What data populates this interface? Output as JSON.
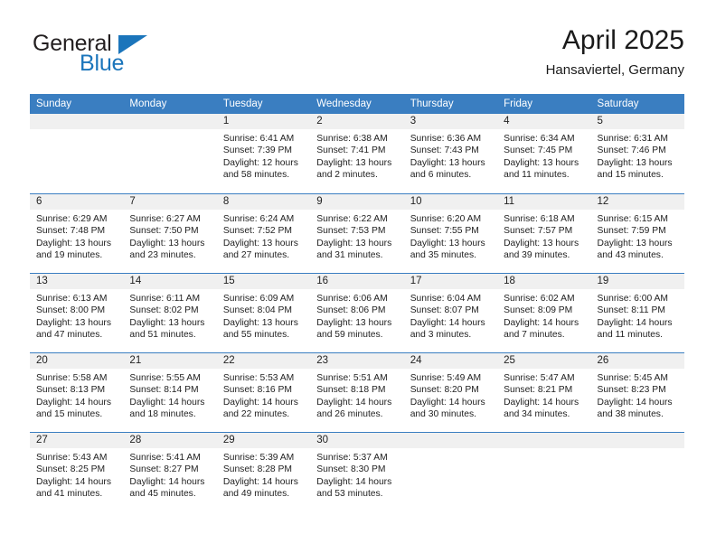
{
  "brand": {
    "name_part1": "General",
    "name_part2": "Blue",
    "triangle_color": "#1b75bb"
  },
  "header": {
    "title": "April 2025",
    "subtitle": "Hansaviertel, Germany"
  },
  "theme": {
    "header_blue": "#3a7ec1",
    "date_band": "#f0f0f0",
    "text": "#222222"
  },
  "weekdays": [
    "Sunday",
    "Monday",
    "Tuesday",
    "Wednesday",
    "Thursday",
    "Friday",
    "Saturday"
  ],
  "weeks": [
    [
      {
        "date": "",
        "lines": []
      },
      {
        "date": "",
        "lines": []
      },
      {
        "date": "1",
        "lines": [
          "Sunrise: 6:41 AM",
          "Sunset: 7:39 PM",
          "Daylight: 12 hours",
          "and 58 minutes."
        ]
      },
      {
        "date": "2",
        "lines": [
          "Sunrise: 6:38 AM",
          "Sunset: 7:41 PM",
          "Daylight: 13 hours",
          "and 2 minutes."
        ]
      },
      {
        "date": "3",
        "lines": [
          "Sunrise: 6:36 AM",
          "Sunset: 7:43 PM",
          "Daylight: 13 hours",
          "and 6 minutes."
        ]
      },
      {
        "date": "4",
        "lines": [
          "Sunrise: 6:34 AM",
          "Sunset: 7:45 PM",
          "Daylight: 13 hours",
          "and 11 minutes."
        ]
      },
      {
        "date": "5",
        "lines": [
          "Sunrise: 6:31 AM",
          "Sunset: 7:46 PM",
          "Daylight: 13 hours",
          "and 15 minutes."
        ]
      }
    ],
    [
      {
        "date": "6",
        "lines": [
          "Sunrise: 6:29 AM",
          "Sunset: 7:48 PM",
          "Daylight: 13 hours",
          "and 19 minutes."
        ]
      },
      {
        "date": "7",
        "lines": [
          "Sunrise: 6:27 AM",
          "Sunset: 7:50 PM",
          "Daylight: 13 hours",
          "and 23 minutes."
        ]
      },
      {
        "date": "8",
        "lines": [
          "Sunrise: 6:24 AM",
          "Sunset: 7:52 PM",
          "Daylight: 13 hours",
          "and 27 minutes."
        ]
      },
      {
        "date": "9",
        "lines": [
          "Sunrise: 6:22 AM",
          "Sunset: 7:53 PM",
          "Daylight: 13 hours",
          "and 31 minutes."
        ]
      },
      {
        "date": "10",
        "lines": [
          "Sunrise: 6:20 AM",
          "Sunset: 7:55 PM",
          "Daylight: 13 hours",
          "and 35 minutes."
        ]
      },
      {
        "date": "11",
        "lines": [
          "Sunrise: 6:18 AM",
          "Sunset: 7:57 PM",
          "Daylight: 13 hours",
          "and 39 minutes."
        ]
      },
      {
        "date": "12",
        "lines": [
          "Sunrise: 6:15 AM",
          "Sunset: 7:59 PM",
          "Daylight: 13 hours",
          "and 43 minutes."
        ]
      }
    ],
    [
      {
        "date": "13",
        "lines": [
          "Sunrise: 6:13 AM",
          "Sunset: 8:00 PM",
          "Daylight: 13 hours",
          "and 47 minutes."
        ]
      },
      {
        "date": "14",
        "lines": [
          "Sunrise: 6:11 AM",
          "Sunset: 8:02 PM",
          "Daylight: 13 hours",
          "and 51 minutes."
        ]
      },
      {
        "date": "15",
        "lines": [
          "Sunrise: 6:09 AM",
          "Sunset: 8:04 PM",
          "Daylight: 13 hours",
          "and 55 minutes."
        ]
      },
      {
        "date": "16",
        "lines": [
          "Sunrise: 6:06 AM",
          "Sunset: 8:06 PM",
          "Daylight: 13 hours",
          "and 59 minutes."
        ]
      },
      {
        "date": "17",
        "lines": [
          "Sunrise: 6:04 AM",
          "Sunset: 8:07 PM",
          "Daylight: 14 hours",
          "and 3 minutes."
        ]
      },
      {
        "date": "18",
        "lines": [
          "Sunrise: 6:02 AM",
          "Sunset: 8:09 PM",
          "Daylight: 14 hours",
          "and 7 minutes."
        ]
      },
      {
        "date": "19",
        "lines": [
          "Sunrise: 6:00 AM",
          "Sunset: 8:11 PM",
          "Daylight: 14 hours",
          "and 11 minutes."
        ]
      }
    ],
    [
      {
        "date": "20",
        "lines": [
          "Sunrise: 5:58 AM",
          "Sunset: 8:13 PM",
          "Daylight: 14 hours",
          "and 15 minutes."
        ]
      },
      {
        "date": "21",
        "lines": [
          "Sunrise: 5:55 AM",
          "Sunset: 8:14 PM",
          "Daylight: 14 hours",
          "and 18 minutes."
        ]
      },
      {
        "date": "22",
        "lines": [
          "Sunrise: 5:53 AM",
          "Sunset: 8:16 PM",
          "Daylight: 14 hours",
          "and 22 minutes."
        ]
      },
      {
        "date": "23",
        "lines": [
          "Sunrise: 5:51 AM",
          "Sunset: 8:18 PM",
          "Daylight: 14 hours",
          "and 26 minutes."
        ]
      },
      {
        "date": "24",
        "lines": [
          "Sunrise: 5:49 AM",
          "Sunset: 8:20 PM",
          "Daylight: 14 hours",
          "and 30 minutes."
        ]
      },
      {
        "date": "25",
        "lines": [
          "Sunrise: 5:47 AM",
          "Sunset: 8:21 PM",
          "Daylight: 14 hours",
          "and 34 minutes."
        ]
      },
      {
        "date": "26",
        "lines": [
          "Sunrise: 5:45 AM",
          "Sunset: 8:23 PM",
          "Daylight: 14 hours",
          "and 38 minutes."
        ]
      }
    ],
    [
      {
        "date": "27",
        "lines": [
          "Sunrise: 5:43 AM",
          "Sunset: 8:25 PM",
          "Daylight: 14 hours",
          "and 41 minutes."
        ]
      },
      {
        "date": "28",
        "lines": [
          "Sunrise: 5:41 AM",
          "Sunset: 8:27 PM",
          "Daylight: 14 hours",
          "and 45 minutes."
        ]
      },
      {
        "date": "29",
        "lines": [
          "Sunrise: 5:39 AM",
          "Sunset: 8:28 PM",
          "Daylight: 14 hours",
          "and 49 minutes."
        ]
      },
      {
        "date": "30",
        "lines": [
          "Sunrise: 5:37 AM",
          "Sunset: 8:30 PM",
          "Daylight: 14 hours",
          "and 53 minutes."
        ]
      },
      {
        "date": "",
        "lines": []
      },
      {
        "date": "",
        "lines": []
      },
      {
        "date": "",
        "lines": []
      }
    ]
  ]
}
